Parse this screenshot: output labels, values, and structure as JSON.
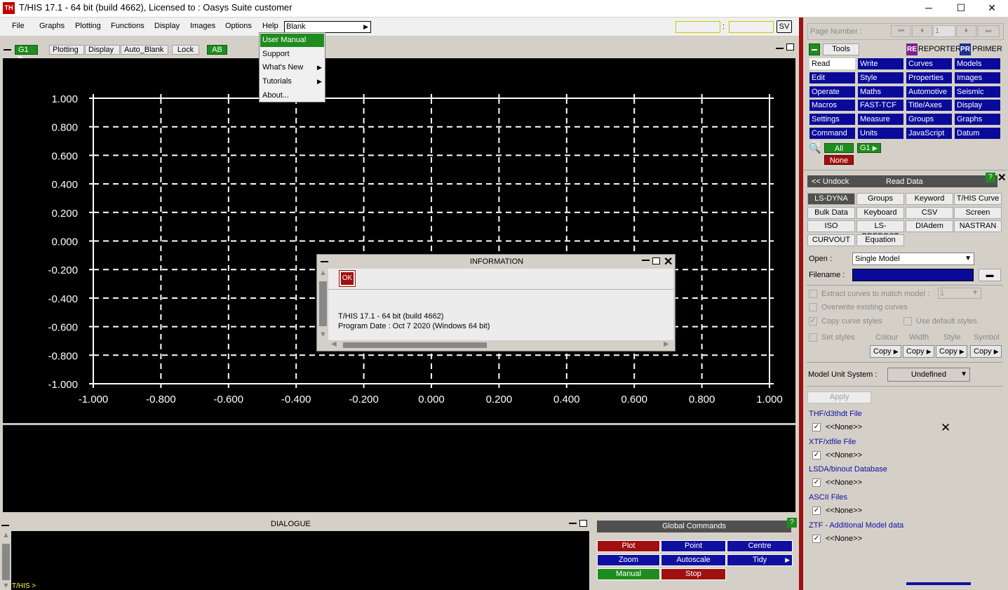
{
  "titlebar": {
    "title": "T/HIS 17.1 - 64 bit (build 4662), Licensed to : Oasys Suite customer",
    "icon": "TH",
    "minimize": "─",
    "maximize": "☐",
    "close": "✕"
  },
  "menubar": {
    "items": [
      "File",
      "Graphs",
      "Plotting",
      "Functions",
      "Display",
      "Images",
      "Options",
      "Help"
    ],
    "blank_select": "Blank",
    "sv": "SV",
    "colon": ":"
  },
  "help_menu": {
    "items": [
      "User Manual",
      "Support",
      "What's New",
      "Tutorials",
      "About..."
    ]
  },
  "toolbar": {
    "g1": "G1",
    "plotting": "Plotting",
    "display": "Display",
    "auto_blank": "Auto_Blank",
    "lock": "Lock",
    "ab": "AB"
  },
  "graph": {
    "y_ticks": [
      "1.000",
      "0.800",
      "0.600",
      "0.400",
      "0.200",
      "0.000",
      "-0.200",
      "-0.400",
      "-0.600",
      "-0.800",
      "-1.000"
    ],
    "x_ticks": [
      "-1.000",
      "-0.800",
      "-0.600",
      "-0.400",
      "-0.200",
      "0.000",
      "0.200",
      "0.400",
      "0.600",
      "0.800",
      "1.000"
    ],
    "grid": true
  },
  "info_dialog": {
    "title": "INFORMATION",
    "ok": "OK",
    "line1": "T/HIS 17.1 - 64 bit (build 4662)",
    "line2": "Program Date : Oct  7 2020  (Windows 64 bit)"
  },
  "dialogue": {
    "title": "DIALOGUE",
    "prompt": "T/HIS >"
  },
  "global_commands": {
    "title": "Global Commands",
    "help": "?",
    "buttons": [
      {
        "label": "Plot",
        "color": "red"
      },
      {
        "label": "Point",
        "color": "blue"
      },
      {
        "label": "Centre",
        "color": "blue"
      },
      {
        "label": "Zoom",
        "color": "blue"
      },
      {
        "label": "Autoscale",
        "color": "blue"
      },
      {
        "label": "Tidy",
        "color": "blue"
      },
      {
        "label": "Manual",
        "color": "green"
      },
      {
        "label": "Stop",
        "color": "red"
      }
    ]
  },
  "right_panel": {
    "page_number_label": "Page Number :",
    "page_number_value": "1",
    "tools": "Tools",
    "reporter": "REPORTER",
    "primer": "PRIMER",
    "tool_grid": [
      [
        "Read",
        "Write",
        "Curves",
        "Models"
      ],
      [
        "Edit",
        "Style",
        "Properties",
        "Images"
      ],
      [
        "Operate",
        "Maths",
        "Automotive",
        "Seismic"
      ],
      [
        "Macros",
        "FAST-TCF",
        "Title/Axes",
        "Display"
      ],
      [
        "Settings",
        "Measure",
        "Groups",
        "Graphs"
      ],
      [
        "Command Fil",
        "Units",
        "JavaScript",
        "Datum"
      ]
    ],
    "all": "All",
    "none": "None",
    "g1": "G1",
    "undock": "<< Undock",
    "read_data": "Read Data",
    "help": "?",
    "close": "✕",
    "read_tabs": [
      [
        "LS-DYNA",
        "Groups",
        "Keyword",
        "T/HIS Curve"
      ],
      [
        "Bulk Data",
        "Keyboard",
        "CSV",
        "Screen"
      ],
      [
        "ISO",
        "LS-PREPOST",
        "DIAdem",
        "NASTRAN"
      ],
      [
        "CURVOUT",
        "Equation",
        "",
        ""
      ]
    ],
    "open_label": "Open :",
    "open_value": "Single Model",
    "filename_label": "Filename :",
    "extract_label": "Extract curves to match model :",
    "extract_value": "1",
    "overwrite_label": "Overwrite existing curves",
    "copy_styles_label": "Copy curve styles",
    "use_default_label": "Use default styles",
    "set_styles_label": "Set styles",
    "style_headers": [
      "Colour",
      "Width",
      "Style",
      "Symbol"
    ],
    "copy_label": "Copy",
    "unit_label": "Model Unit System :",
    "unit_value": "Undefined",
    "apply": "Apply",
    "sections": [
      {
        "title": "THF/d3thdt File",
        "value": "<<None>>"
      },
      {
        "title": "XTF/xtfile File",
        "value": "<<None>>"
      },
      {
        "title": "LSDA/binout Database",
        "value": "<<None>>"
      },
      {
        "title": "ASCII Files",
        "value": "<<None>>"
      },
      {
        "title": "ZTF - Additional Model data",
        "value": "<<None>>"
      }
    ]
  }
}
